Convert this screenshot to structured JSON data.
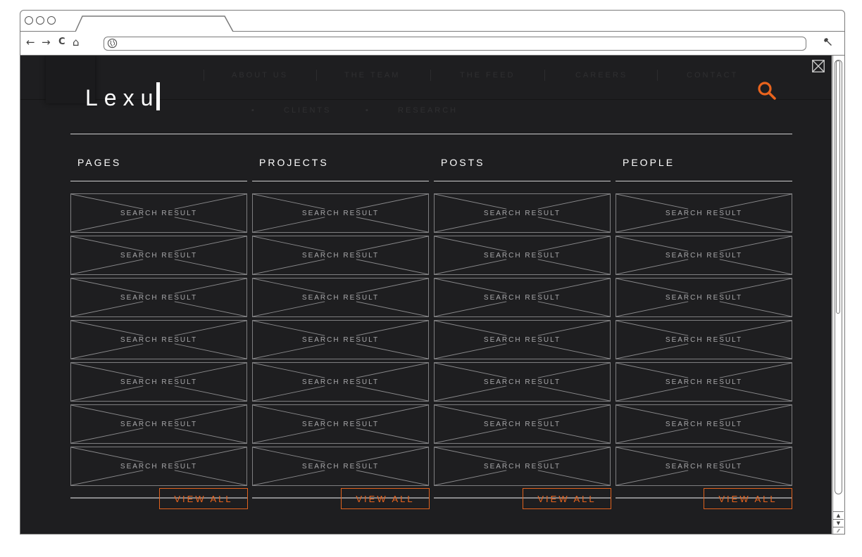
{
  "browser": {
    "nav": {
      "back": "←",
      "forward": "→",
      "reload": "C",
      "home": "⌂",
      "wrench": "🔧"
    }
  },
  "site_nav_ghost": {
    "row1": [
      "ABOUT US",
      "THE TEAM",
      "THE FEED",
      "CAREERS",
      "CONTACT"
    ],
    "row2": [
      "CLIENTS",
      "RESEARCH"
    ]
  },
  "search": {
    "query": "Lexu",
    "accent": "#e8631d"
  },
  "columns": [
    {
      "title": "PAGES",
      "results": [
        "SEARCH RESULT",
        "SEARCH RESULT",
        "SEARCH RESULT",
        "SEARCH RESULT",
        "SEARCH RESULT",
        "SEARCH RESULT",
        "SEARCH RESULT"
      ],
      "view_all": "VIEW ALL"
    },
    {
      "title": "PROJECTS",
      "results": [
        "SEARCH RESULT",
        "SEARCH RESULT",
        "SEARCH RESULT",
        "SEARCH RESULT",
        "SEARCH RESULT",
        "SEARCH RESULT",
        "SEARCH RESULT"
      ],
      "view_all": "VIEW ALL"
    },
    {
      "title": "POSTS",
      "results": [
        "SEARCH RESULT",
        "SEARCH RESULT",
        "SEARCH RESULT",
        "SEARCH RESULT",
        "SEARCH RESULT",
        "SEARCH RESULT",
        "SEARCH RESULT"
      ],
      "view_all": "VIEW ALL"
    },
    {
      "title": "PEOPLE",
      "results": [
        "SEARCH RESULT",
        "SEARCH RESULT",
        "SEARCH RESULT",
        "SEARCH RESULT",
        "SEARCH RESULT",
        "SEARCH RESULT",
        "SEARCH RESULT"
      ],
      "view_all": "VIEW ALL"
    }
  ]
}
